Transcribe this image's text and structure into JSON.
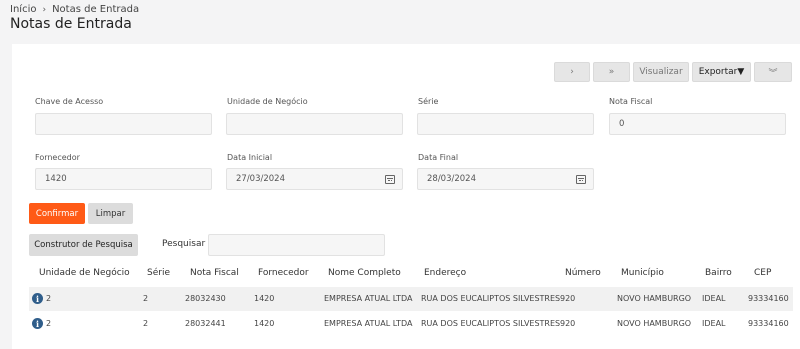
{
  "breadcrumb": {
    "home": "Início",
    "separator": "›",
    "current": "Notas de Entrada"
  },
  "page_title": "Notas de Entrada",
  "toolbar": {
    "next_icon": "chevron-right-icon",
    "last_icon": "double-chevron-right-icon",
    "visualizar": "Visualizar",
    "exportar": "Exportar▼",
    "collapse_icon": "double-chevron-down-icon",
    "next_glyph": "›",
    "last_glyph": "»",
    "collapse_glyph": "︾"
  },
  "filters": {
    "chave_acesso": {
      "label": "Chave de Acesso",
      "value": ""
    },
    "unidade_negocio": {
      "label": "Unidade de Negócio",
      "value": ""
    },
    "serie": {
      "label": "Série",
      "value": ""
    },
    "nota_fiscal": {
      "label": "Nota Fiscal",
      "value": "0"
    },
    "fornecedor": {
      "label": "Fornecedor",
      "value": "1420"
    },
    "data_inicial": {
      "label": "Data Inicial",
      "value": "27/03/2024"
    },
    "data_final": {
      "label": "Data Final",
      "value": "28/03/2024"
    }
  },
  "actions": {
    "confirmar": "Confirmar",
    "limpar": "Limpar",
    "construtor": "Construtor de Pesquisa"
  },
  "search": {
    "label": "Pesquisar",
    "value": ""
  },
  "table": {
    "headers": [
      "Unidade de Negócio",
      "Série",
      "Nota Fiscal",
      "Fornecedor",
      "Nome Completo",
      "Endereço",
      "Número",
      "Município",
      "Bairro",
      "CEP"
    ],
    "rows": [
      [
        "2",
        "2",
        "28032430",
        "1420",
        "EMPRESA ATUAL LTDA",
        "RUA DOS EUCALIPTOS SILVESTRES",
        "920",
        "NOVO HAMBURGO",
        "IDEAL",
        "93334160"
      ],
      [
        "2",
        "2",
        "28032441",
        "1420",
        "EMPRESA ATUAL LTDA",
        "RUA DOS EUCALIPTOS SILVESTRES",
        "920",
        "NOVO HAMBURGO",
        "IDEAL",
        "93334160"
      ]
    ],
    "row_icon": "info-icon",
    "row_icon_glyph": "i"
  },
  "colors": {
    "accent": "#ff5a16",
    "background": "#f4f4f5",
    "card": "#ffffff",
    "info_icon": "#2f5d8a"
  }
}
